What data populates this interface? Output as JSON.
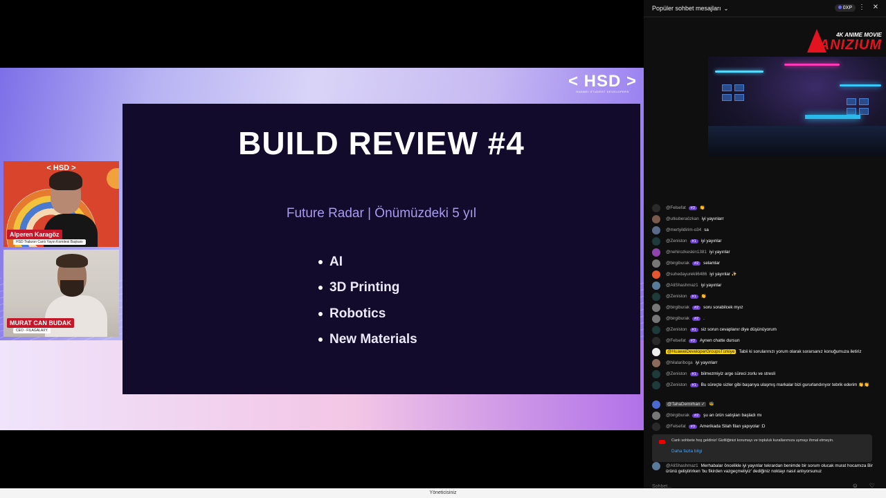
{
  "slide": {
    "logo": "< HSD >",
    "logo_sub": "HUAWEI STUDENT DEVELOPERS",
    "title": "BUILD REVIEW #4",
    "subtitle": "Future Radar | Önümüzdeki 5 yıl",
    "bullets": [
      "AI",
      "3D Printing",
      "Robotics",
      "New Materials"
    ]
  },
  "cams": [
    {
      "logo": "< HSD >",
      "name": "Alperen Karagöz",
      "role": "HSD Trabzon Canlı Yayın Komitesi Başkanı"
    },
    {
      "name": "MURAT CAN BUDAK",
      "role": "CEO - FILAGALAXY"
    }
  ],
  "bottom_bar": "Yöneticisiniz",
  "chat": {
    "header": "Popüler sohbet mesajları",
    "xp": "0XP",
    "ad": {
      "brand_sub": "4K ANIME MOVIE",
      "brand": "ANIZIUM"
    },
    "messages": [
      {
        "author": "@Felsefat",
        "badge": "#3",
        "text": "👏",
        "avatar_color": "#2a2a2a"
      },
      {
        "author": "@utkuberaözkan",
        "badge": "",
        "text": "iyi yayınlarr",
        "avatar_color": "#7a5a4a"
      },
      {
        "author": "@mertyildirim-o34",
        "badge": "",
        "text": "sa",
        "avatar_color": "#5a6a8a"
      },
      {
        "author": "@Zeniston",
        "badge": "#1",
        "text": "iyi yayınlar",
        "avatar_color": "#1f3a3a"
      },
      {
        "author": "@nehirozkeskin1381",
        "badge": "",
        "text": "iyi yayınlar",
        "avatar_color": "#8e44ad"
      },
      {
        "author": "@birgiburak",
        "badge": "#2",
        "text": "selamlar",
        "avatar_color": "#777"
      },
      {
        "author": "@suhedayurekli6486",
        "badge": "",
        "text": "iyi yayınlar ✨",
        "avatar_color": "#e4572e"
      },
      {
        "author": "@AliShashmaz1",
        "badge": "",
        "text": "iyi yayınlar",
        "avatar_color": "#5a7a9a"
      },
      {
        "author": "@Zeniston",
        "badge": "#1",
        "text": "👏",
        "avatar_color": "#1f3a3a"
      },
      {
        "author": "@birgiburak",
        "badge": "#2",
        "text": "soru sorabilcek myız",
        "avatar_color": "#777"
      },
      {
        "author": "@birgiburak",
        "badge": "#2",
        "text": ".",
        "avatar_color": "#777"
      },
      {
        "author": "@Zeniston",
        "badge": "#1",
        "text": "siz sorun cevaplanır diye düşünüyorum",
        "avatar_color": "#1f3a3a"
      },
      {
        "author": "@Felsefat",
        "badge": "#3",
        "text": "Aynen chatte dursun",
        "avatar_color": "#2a2a2a"
      },
      {
        "author": "@HuaweiDeveloperGroupsTürkiye",
        "badge": "",
        "text": "Tabii ki sorularınızı yorum olarak sorarsanız konuğumuza iletiriz",
        "avatar_color": "#eee",
        "highlight": true
      },
      {
        "author": "@hilalariboga",
        "badge": "",
        "text": "iyi yayınlarr",
        "avatar_color": "#8a6a5a"
      },
      {
        "author": "@Zeniston",
        "badge": "#1",
        "text": "bilmezmiyiz arge süreci zorlu ve stresli",
        "avatar_color": "#1f3a3a"
      },
      {
        "author": "@Zeniston",
        "badge": "#1",
        "text": "Bu süreçte sizler gibi başarıya ulaşmış markalar bizi gururlandırıyor tebrik ederim 👏👏",
        "avatar_color": "#1f3a3a",
        "tall": true
      },
      {
        "author": "@TahaDemirhan ✓",
        "badge": "",
        "text": "🐝",
        "avatar_color": "#4a6ad0",
        "mod": true
      },
      {
        "author": "@birgiburak",
        "badge": "#2",
        "text": "şu an ürün satışları başladı mı",
        "avatar_color": "#777"
      },
      {
        "author": "@Felsefat",
        "badge": "#3",
        "text": "Amerikada Silah filan yapıyolar :D",
        "avatar_color": "#2a2a2a"
      }
    ],
    "notice": {
      "text": "Canlı sohbete hoş geldiniz! Gizliliğinizi korumayı ve topluluk kurallarımıza uymayı ihmal etmeyin.",
      "link": "Daha fazla bilgi"
    },
    "last_message": {
      "author": "@AliShashmaz1",
      "text": "Merhabalar öncelikle iyi yayınlar tekrardan benimde bir sorum olucak murat hocamıza Bir ürünü geliştirirken 'bu fikirden vazgeçmeliyiz' dediğiniz noktayı nasıl anlıyorsunuz"
    },
    "input_placeholder": "Sohbet..."
  }
}
